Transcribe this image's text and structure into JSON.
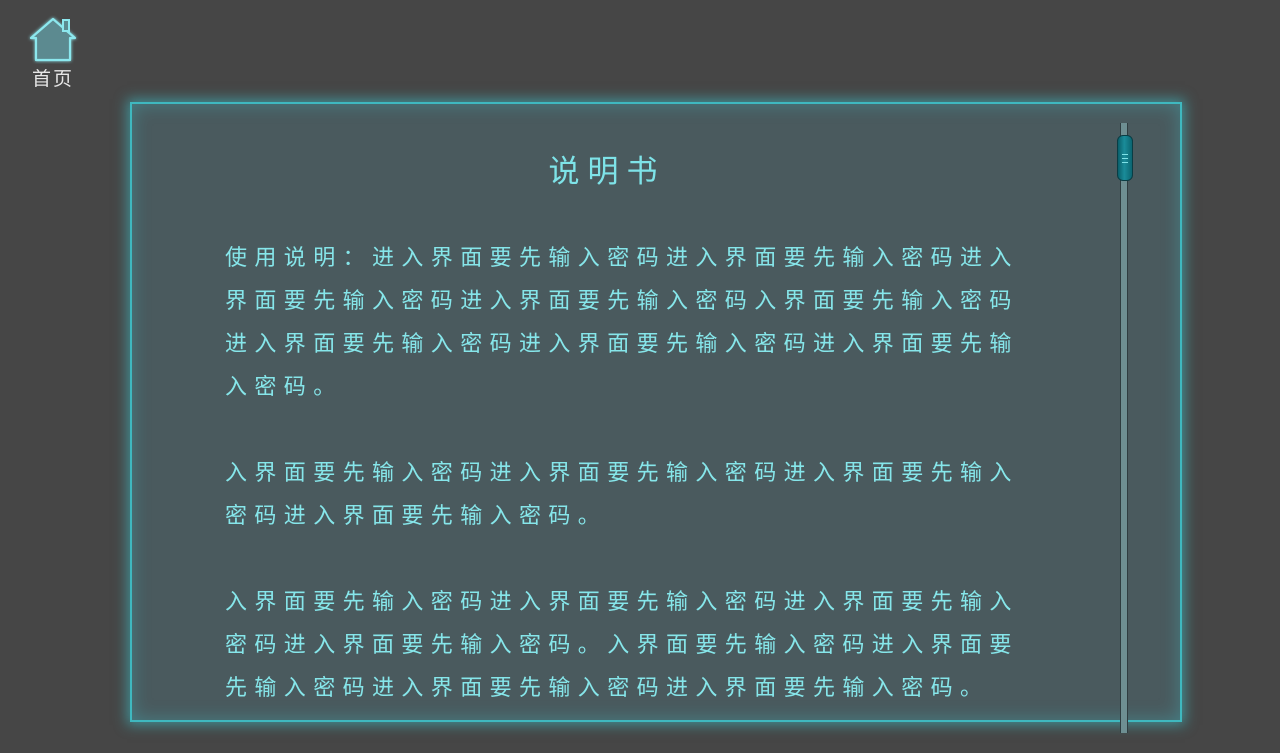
{
  "nav": {
    "home_label": "首页",
    "home_icon": "home-icon"
  },
  "document": {
    "title": "说明书",
    "paragraphs": [
      "使用说明：进入界面要先输入密码进入界面要先输入密码进入界面要先输入密码进入界面要先输入密码入界面要先输入密码进入界面要先输入密码进入界面要先输入密码进入界面要先输入密码。",
      "入界面要先输入密码进入界面要先输入密码进入界面要先输入密码进入界面要先输入密码。",
      "入界面要先输入密码进入界面要先输入密码进入界面要先输入密码进入界面要先输入密码。入界面要先输入密码进入界面要先输入密码进入界面要先输入密码进入界面要先输入密码。"
    ]
  },
  "colors": {
    "background": "#464646",
    "panel": "#4a5a5e",
    "accent": "#3fb8bf",
    "text": "#86e6ea"
  }
}
